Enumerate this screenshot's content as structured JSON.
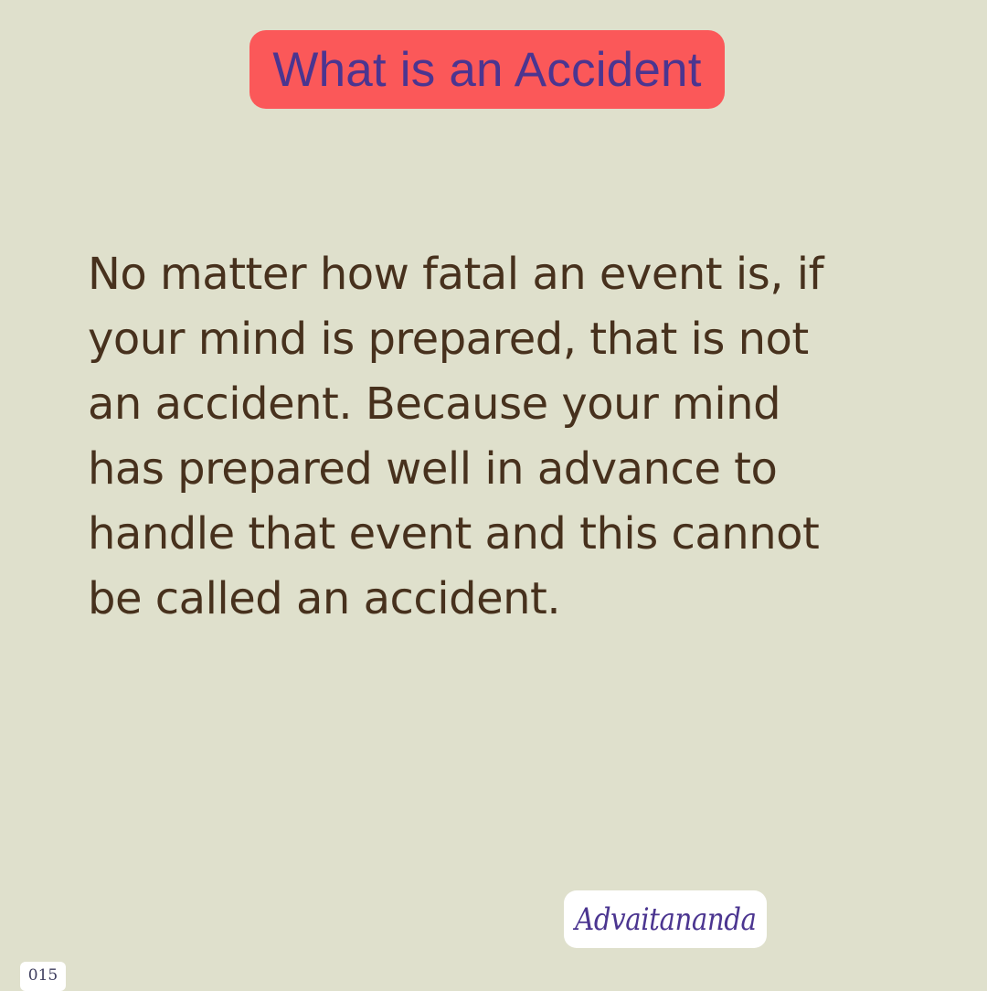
{
  "header": {
    "title": "What is an Accident"
  },
  "quote": {
    "lines": [
      "No matter how fatal an event is, if",
      "your mind is prepared, that is not",
      "an accident. Because your mind",
      "has prepared well in advance to",
      "handle that event and this cannot",
      "be called an accident."
    ]
  },
  "footer": {
    "author": "Advaitananda",
    "page_number": "015"
  },
  "colors": {
    "background": "#dfe0cc",
    "title_badge": "#fb5859",
    "title_text": "#4b3590",
    "body_text": "#47311d",
    "author_card": "#ffffff"
  }
}
